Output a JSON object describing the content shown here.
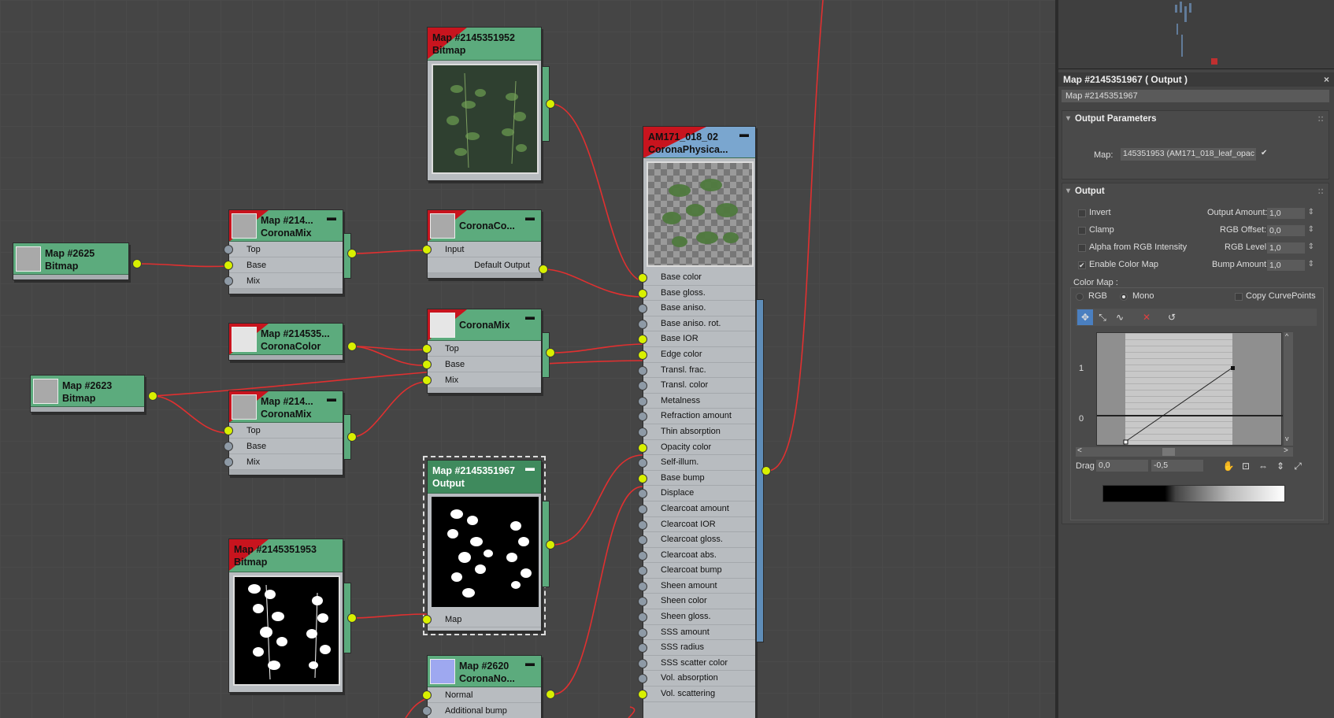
{
  "graph": {
    "nodes": {
      "map2625": {
        "title": "Map #2625",
        "sub": "Bitmap"
      },
      "map2623": {
        "title": "Map #2623",
        "sub": "Bitmap"
      },
      "cmix1": {
        "title": "Map #214...",
        "sub": "CoronaMix",
        "min": "▬",
        "rows": [
          "Top",
          "Base",
          "Mix"
        ]
      },
      "ccolor": {
        "title": "Map #214535...",
        "sub": "CoronaColor"
      },
      "cmix2": {
        "title": "Map #214...",
        "sub": "CoronaMix",
        "min": "▬",
        "rows": [
          "Top",
          "Base",
          "Mix"
        ]
      },
      "bm1952": {
        "title": "Map #2145351952",
        "sub": "Bitmap"
      },
      "coronaco": {
        "title": "CoronaCo...",
        "min": "▬",
        "rows": [
          "Input",
          "Default Output"
        ]
      },
      "cmix3": {
        "title": "CoronaMix",
        "min": "▬",
        "rows": [
          "Top",
          "Base",
          "Mix"
        ]
      },
      "output": {
        "title": "Map #2145351967",
        "sub": "Output",
        "min": "▬",
        "rows": [
          "Map"
        ]
      },
      "bm1953": {
        "title": "Map #2145351953",
        "sub": "Bitmap"
      },
      "cnormal": {
        "title": "Map #2620",
        "sub": "CoronaNo...",
        "min": "▬",
        "rows": [
          "Normal",
          "Additional bump"
        ]
      },
      "phys": {
        "title": "AM171_018_02",
        "sub": "CoronaPhysica...",
        "min": "▬",
        "rows": [
          "Base color",
          "Base gloss.",
          "Base aniso.",
          "Base aniso. rot.",
          "Base IOR",
          "Edge color",
          "Transl. frac.",
          "Transl. color",
          "Metalness",
          "Refraction amount",
          "Thin absorption",
          "Opacity color",
          "Self-illum.",
          "Base bump",
          "Displace",
          "Clearcoat amount",
          "Clearcoat IOR",
          "Clearcoat gloss.",
          "Clearcoat abs.",
          "Clearcoat bump",
          "Sheen amount",
          "Sheen color",
          "Sheen gloss.",
          "SSS amount",
          "SSS radius",
          "SSS scatter color",
          "Vol. absorption",
          "Vol. scattering"
        ]
      }
    }
  },
  "panel": {
    "title": "Map #2145351967  ( Output )",
    "close": "×",
    "map_name": "Map #2145351967",
    "output_params": {
      "header": "Output Parameters",
      "pin": "::",
      "map_label": "Map:",
      "map_value": "145351953 (AM171_018_leaf_opac",
      "check": "✔"
    },
    "output": {
      "header": "Output",
      "pin": "::",
      "invert": "Invert",
      "clamp": "Clamp",
      "alpha": "Alpha from RGB Intensity",
      "enable": "Enable Color Map",
      "enable_check": "✔",
      "output_amount_label": "Output Amount:",
      "output_amount": "1,0",
      "rgb_offset_label": "RGB Offset:",
      "rgb_offset": "0,0",
      "rgb_level_label": "RGB Level:",
      "rgb_level": "1,0",
      "bump_amount_label": "Bump Amount:",
      "bump_amount": "1,0",
      "color_map_label": "Color Map :",
      "rgb": "RGB",
      "mono": "Mono",
      "copy_curve": "Copy CurvePoints",
      "axis_1": "1",
      "axis_0": "0",
      "drag_label": "Drag",
      "drag_x": "0,0",
      "drag_y": "-0,5",
      "scroll_left": "<",
      "scroll_right": ">",
      "scroll_up": "^",
      "scroll_down": "v"
    }
  }
}
